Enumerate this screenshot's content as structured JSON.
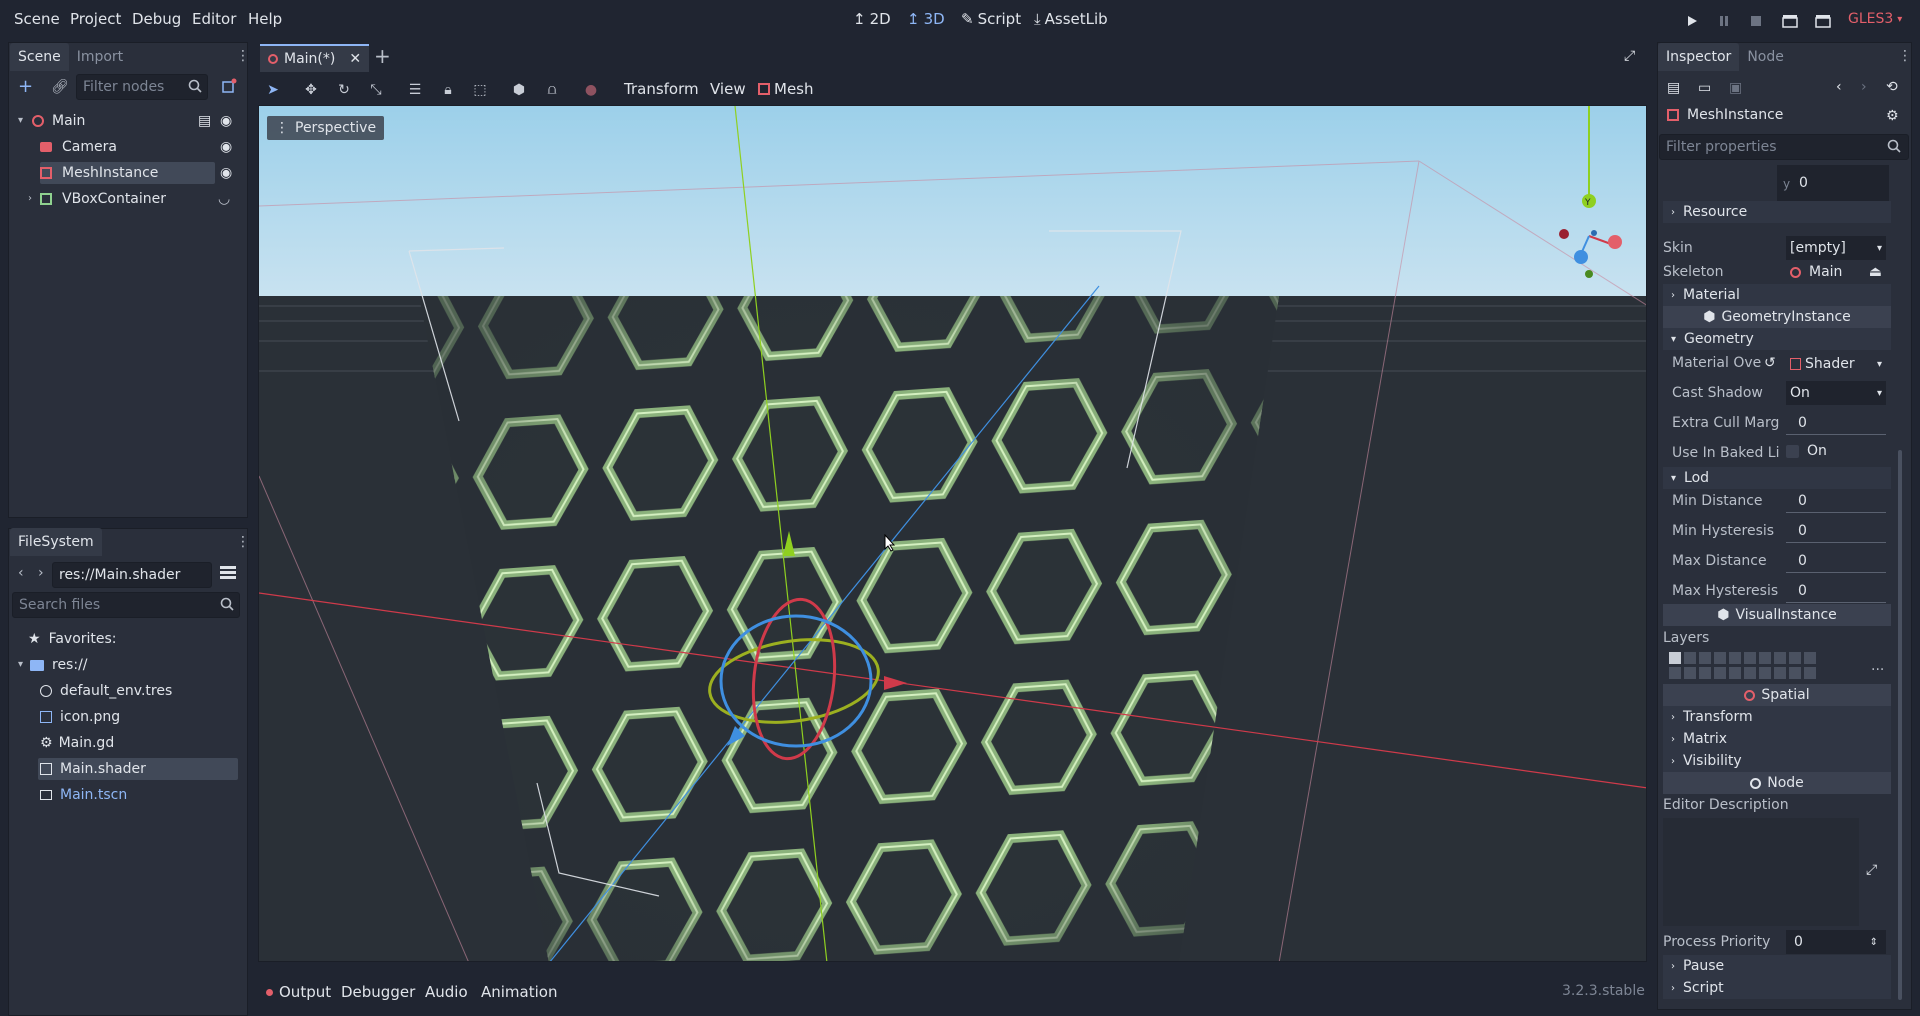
{
  "menu": [
    "Scene",
    "Project",
    "Debug",
    "Editor",
    "Help"
  ],
  "workspaces": [
    {
      "label": "2D",
      "active": false
    },
    {
      "label": "3D",
      "active": true
    },
    {
      "label": "Script",
      "active": false
    },
    {
      "label": "AssetLib",
      "active": false
    }
  ],
  "renderer": "GLES3",
  "scene_dock": {
    "tabs": [
      "Scene",
      "Import"
    ],
    "filter_placeholder": "Filter nodes",
    "nodes": [
      {
        "label": "Main",
        "icon": "spatial-icon"
      },
      {
        "label": "Camera",
        "icon": "camera-icon"
      },
      {
        "label": "MeshInstance",
        "icon": "mesh-icon",
        "selected": true
      },
      {
        "label": "VBoxContainer",
        "icon": "vbox-icon"
      }
    ]
  },
  "filesystem": {
    "title": "FileSystem",
    "path": "res://Main.shader",
    "search_placeholder": "Search files",
    "items": [
      {
        "label": "Favorites:",
        "icon": "star-icon"
      },
      {
        "label": "res://",
        "icon": "folder-icon"
      },
      {
        "label": "default_env.tres",
        "icon": "globe-icon"
      },
      {
        "label": "icon.png",
        "icon": "image-icon"
      },
      {
        "label": "Main.gd",
        "icon": "gear-icon"
      },
      {
        "label": "Main.shader",
        "icon": "shader-icon",
        "selected": true
      },
      {
        "label": "Main.tscn",
        "icon": "scene-icon",
        "highlight": true
      }
    ]
  },
  "editor": {
    "tab": "Main(*)",
    "menus": [
      "Transform",
      "View",
      "Mesh"
    ],
    "viewport_label": "Perspective"
  },
  "bottom_tabs": [
    "Output",
    "Debugger",
    "Audio",
    "Animation"
  ],
  "version": "3.2.3.stable",
  "inspector": {
    "tabs": [
      "Inspector",
      "Node"
    ],
    "object": "MeshInstance",
    "filter_placeholder": "Filter properties",
    "y_label": "y",
    "y_value": "0",
    "resource": "Resource",
    "skin_label": "Skin",
    "skin_value": "[empty]",
    "skeleton_label": "Skeleton",
    "skeleton_value": "Main",
    "material": "Material",
    "geometry_instance": "GeometryInstance",
    "geometry": "Geometry",
    "material_override_label": "Material Ove",
    "material_override_value": "Shader",
    "cast_shadow_label": "Cast Shadow",
    "cast_shadow_value": "On",
    "extra_cull_label": "Extra Cull Marg",
    "extra_cull_value": "0",
    "baked_label": "Use In Baked Li",
    "baked_value": "On",
    "lod": "Lod",
    "min_distance_label": "Min Distance",
    "min_distance_value": "0",
    "min_hysteresis_label": "Min Hysteresis",
    "min_hysteresis_value": "0",
    "max_distance_label": "Max Distance",
    "max_distance_value": "0",
    "max_hysteresis_label": "Max Hysteresis",
    "max_hysteresis_value": "0",
    "visual_instance": "VisualInstance",
    "layers": "Layers",
    "layers_more": "...",
    "spatial": "Spatial",
    "transform": "Transform",
    "matrix": "Matrix",
    "visibility": "Visibility",
    "node": "Node",
    "editor_description": "Editor Description",
    "process_priority_label": "Process Priority",
    "process_priority_value": "0",
    "pause": "Pause",
    "script": "Script"
  }
}
